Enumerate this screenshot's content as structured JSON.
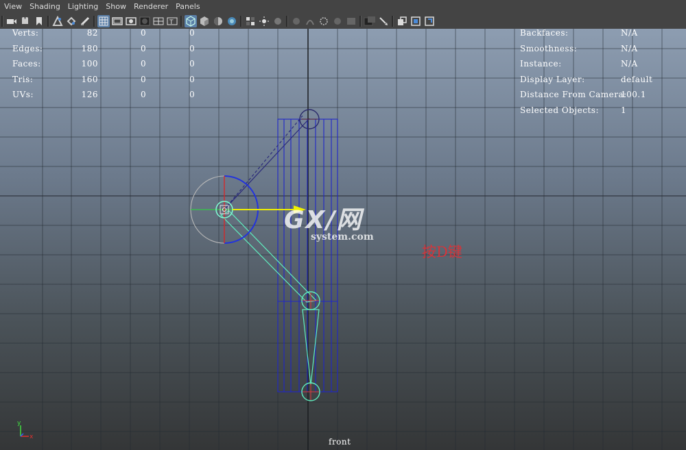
{
  "menu": [
    "View",
    "Shading",
    "Lighting",
    "Show",
    "Renderer",
    "Panels"
  ],
  "toolbar_icons": [
    "camera-attributes-icon",
    "camera-select-icon",
    "bookmark-icon",
    "image-plane-icon",
    "2d-pan-zoom-icon",
    "grease-pencil-icon",
    "grid-icon",
    "film-gate-icon",
    "resolution-gate-icon",
    "gate-mask-icon",
    "field-chart-icon",
    "safe-action-icon",
    "wireframe-icon",
    "smooth-shade-icon",
    "default-material-icon",
    "textured-icon",
    "use-lights-icon",
    "shadows-icon",
    "ambient-occlusion-icon",
    "motion-blur-icon",
    "anti-alias-icon",
    "depth-of-field-icon",
    "isolate-select-icon",
    "xray-icon",
    "xray-joints-icon",
    "xray-active-icon",
    "resolution-icon"
  ],
  "hud_left": [
    {
      "label": "Verts:",
      "v1": "82",
      "v2": "0",
      "v3": "0"
    },
    {
      "label": "Edges:",
      "v1": "180",
      "v2": "0",
      "v3": "0"
    },
    {
      "label": "Faces:",
      "v1": "100",
      "v2": "0",
      "v3": "0"
    },
    {
      "label": "Tris:",
      "v1": "160",
      "v2": "0",
      "v3": "0"
    },
    {
      "label": "UVs:",
      "v1": "126",
      "v2": "0",
      "v3": "0"
    }
  ],
  "hud_right": [
    {
      "label": "Backfaces:",
      "value": "N/A"
    },
    {
      "label": "Smoothness:",
      "value": "N/A"
    },
    {
      "label": "Instance:",
      "value": "N/A"
    },
    {
      "label": "Display Layer:",
      "value": "default"
    },
    {
      "label": "Distance From Camera:",
      "value": "100.1"
    },
    {
      "label": "Selected Objects:",
      "value": "1"
    }
  ],
  "camera_name": "front",
  "annotation": "按D键",
  "watermark": {
    "main": "GX/网",
    "sub": "system.com"
  },
  "axis": {
    "y": "y",
    "x": "x"
  },
  "colors": {
    "accent": "#5a7fa8",
    "wire": "#1f26c8",
    "joint": "#5ff0c0",
    "red": "#d4343a"
  }
}
